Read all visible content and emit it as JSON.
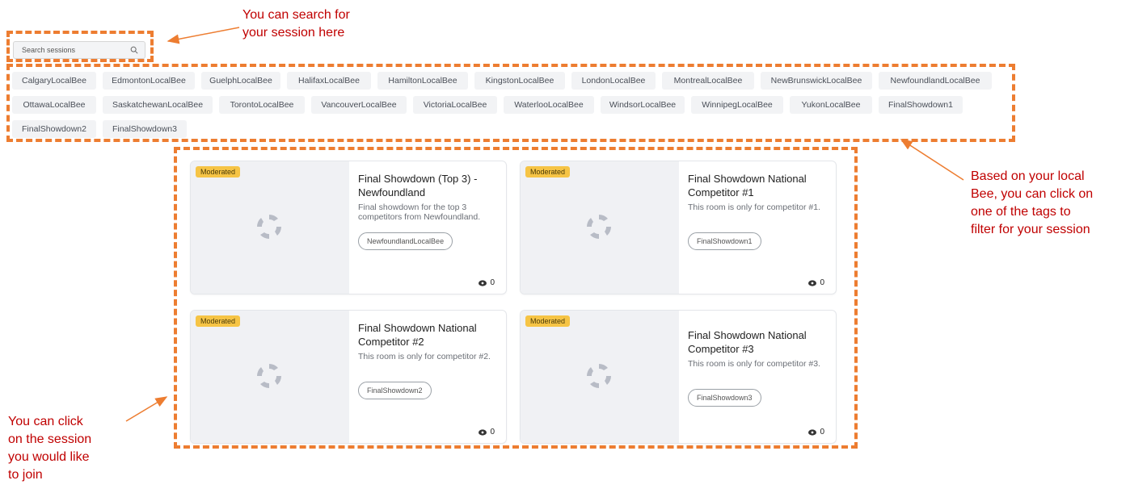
{
  "search": {
    "placeholder": "Search sessions"
  },
  "tags": [
    "CalgaryLocalBee",
    "EdmontonLocalBee",
    "GuelphLocalBee",
    "HalifaxLocalBee",
    "HamiltonLocalBee",
    "KingstonLocalBee",
    "LondonLocalBee",
    "MontrealLocalBee",
    "NewBrunswickLocalBee",
    "NewfoundlandLocalBee",
    "OttawaLocalBee",
    "SaskatchewanLocalBee",
    "TorontoLocalBee",
    "VancouverLocalBee",
    "VictoriaLocalBee",
    "WaterlooLocalBee",
    "WindsorLocalBee",
    "WinnipegLocalBee",
    "YukonLocalBee",
    "FinalShowdown1",
    "FinalShowdown2",
    "FinalShowdown3"
  ],
  "cards": [
    {
      "badge": "Moderated",
      "title": "Final Showdown (Top 3) - Newfoundland",
      "description": "Final showdown for the top 3 competitors from Newfoundland.",
      "tag": "NewfoundlandLocalBee",
      "views": "0"
    },
    {
      "badge": "Moderated",
      "title": "Final Showdown National Competitor #1",
      "description": "This room is only for competitor #1.",
      "tag": "FinalShowdown1",
      "views": "0"
    },
    {
      "badge": "Moderated",
      "title": "Final Showdown National Competitor #2",
      "description": "This room is only for competitor #2.",
      "tag": "FinalShowdown2",
      "views": "0"
    },
    {
      "badge": "Moderated",
      "title": "Final Showdown National Competitor #3",
      "description": "This room is only for competitor #3.",
      "tag": "FinalShowdown3",
      "views": "0"
    }
  ],
  "annotations": {
    "search_line1": "You can search for",
    "search_line2": "your session here",
    "tags_line1": "Based on your local",
    "tags_line2": "Bee, you can click on",
    "tags_line3": "one of the tags to",
    "tags_line4": "filter for your session",
    "cards_line1": "You can click",
    "cards_line2": "on the session",
    "cards_line3": "you would like",
    "cards_line4": "to join"
  },
  "colors": {
    "annotation_text": "#c00000",
    "annotation_border": "#ed7d31",
    "badge": "#f6c445"
  }
}
